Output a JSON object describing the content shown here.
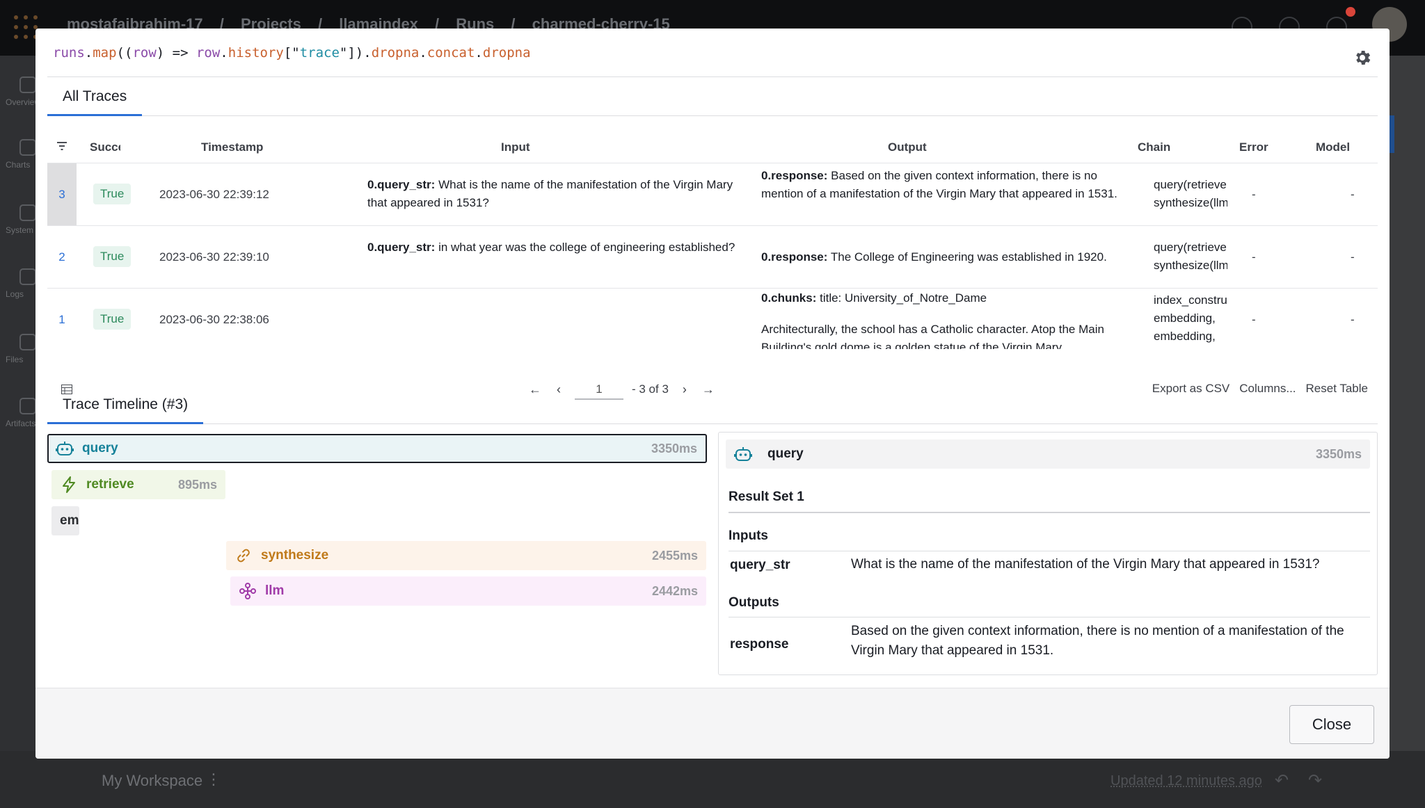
{
  "background": {
    "breadcrumbs": [
      "mostafaibrahim-17",
      "Projects",
      "llamaindex",
      "Runs",
      "charmed-cherry-15"
    ],
    "sidebar_items": [
      "Overview",
      "Charts",
      "System",
      "Logs",
      "Files",
      "Artifacts"
    ],
    "workspace_label": "My Workspace",
    "updated_label": "Updated 12 minutes ago"
  },
  "modal": {
    "expression": {
      "tokens": [
        {
          "text": "runs",
          "cls": "t-a"
        },
        {
          "text": ".",
          "cls": "t-c"
        },
        {
          "text": "map",
          "cls": "t-b"
        },
        {
          "text": "((",
          "cls": "t-c"
        },
        {
          "text": "row",
          "cls": "t-a"
        },
        {
          "text": ") => ",
          "cls": "t-c"
        },
        {
          "text": "row",
          "cls": "t-a"
        },
        {
          "text": ".",
          "cls": "t-c"
        },
        {
          "text": "history",
          "cls": "t-b"
        },
        {
          "text": "[\"",
          "cls": "t-c"
        },
        {
          "text": "trace",
          "cls": "t-d"
        },
        {
          "text": "\"]).",
          "cls": "t-c"
        },
        {
          "text": "dropna",
          "cls": "t-b"
        },
        {
          "text": ".",
          "cls": "t-c"
        },
        {
          "text": "concat",
          "cls": "t-b"
        },
        {
          "text": ".",
          "cls": "t-c"
        },
        {
          "text": "dropna",
          "cls": "t-b"
        }
      ]
    },
    "tab_all_traces": "All Traces",
    "table": {
      "headers": {
        "success": "Succe",
        "timestamp": "Timestamp",
        "input": "Input",
        "output": "Output",
        "chain": "Chain",
        "error": "Error",
        "model": "Model"
      },
      "rows": [
        {
          "index": "3",
          "success": "True",
          "timestamp": "2023-06-30 22:39:12",
          "input_key": "0.query_str:",
          "input_val": "What is the name of the manifestation of the Virgin Mary that appeared in 1531?",
          "output_key": "0.response:",
          "output_val": "Based on the given context information, there is no mention of a manifestation of the Virgin Mary that appeared in 1531.",
          "chain_1": "query(retrieve",
          "chain_2": "synthesize(llm",
          "error": "-",
          "model": "-"
        },
        {
          "index": "2",
          "success": "True",
          "timestamp": "2023-06-30 22:39:10",
          "input_key": "0.query_str:",
          "input_val": "in what year was the college of engineering established?",
          "output_key": "0.response:",
          "output_val": "The College of Engineering was established in 1920.",
          "chain_1": "query(retrieve",
          "chain_2": "synthesize(llm",
          "error": "-",
          "model": "-"
        },
        {
          "index": "1",
          "success": "True",
          "timestamp": "2023-06-30 22:38:06",
          "input_key": "",
          "input_val": "",
          "output_key": "0.chunks:",
          "output_val": "title: University_of_Notre_Dame",
          "output_extra": "Architecturally, the school has a Catholic character. Atop the Main Building's gold dome is a golden statue of the Virgin Mary",
          "chain_1": "index_constru",
          "chain_2": "embedding,",
          "chain_3": "embedding,",
          "error": "-",
          "model": "-"
        }
      ],
      "pagination": {
        "first": "←",
        "prev": "‹",
        "page": "1",
        "range": "- 3 of 3",
        "next": "›",
        "last": "→"
      },
      "export_csv": "Export as CSV",
      "columns": "Columns...",
      "reset_table": "Reset Table"
    },
    "tab_timeline": "Trace Timeline (#3)",
    "timeline": {
      "spans": {
        "query": {
          "name": "query",
          "duration": "3350ms"
        },
        "retrieve": {
          "name": "retrieve",
          "duration": "895ms"
        },
        "embedding": {
          "name": "em"
        },
        "synthesize": {
          "name": "synthesize",
          "duration": "2455ms"
        },
        "llm": {
          "name": "llm",
          "duration": "2442ms"
        }
      }
    },
    "detail": {
      "name": "query",
      "duration": "3350ms",
      "result_set": "Result Set 1",
      "inputs_title": "Inputs",
      "input_key": "query_str",
      "input_value": "What is the name of the manifestation of the Virgin Mary that appeared in 1531?",
      "outputs_title": "Outputs",
      "output_key": "response",
      "output_value": "Based on the given context information, there is no mention of a manifestation of the Virgin Mary that appeared in 1531."
    },
    "close_label": "Close"
  }
}
